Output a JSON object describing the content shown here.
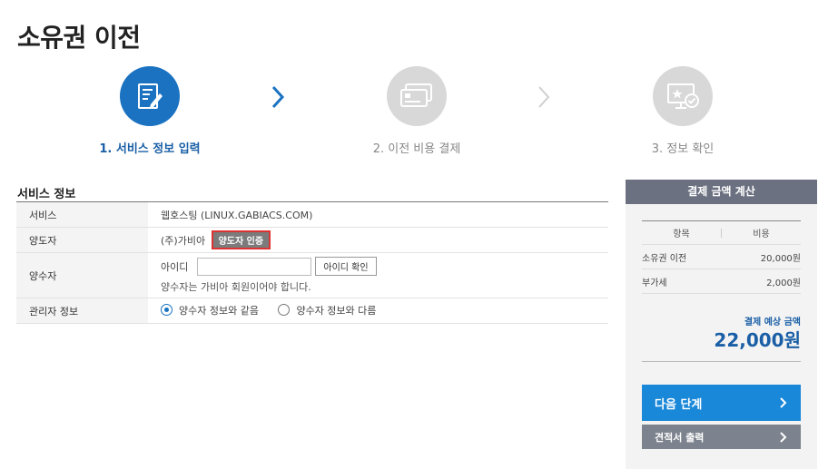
{
  "page": {
    "title": "소유권 이전"
  },
  "steps": [
    {
      "label": "1. 서비스 정보 입력",
      "icon": "form-edit-icon",
      "state": "active"
    },
    {
      "label": "2. 이전 비용 결제",
      "icon": "credit-card-icon",
      "state": "inactive"
    },
    {
      "label": "3. 정보 확인",
      "icon": "monitor-check-icon",
      "state": "inactive"
    }
  ],
  "service_info": {
    "title": "서비스 정보",
    "rows": {
      "service": {
        "label": "서비스",
        "value": "웹호스팅 (LINUX.GABIACS.COM)"
      },
      "transferor": {
        "label": "양도자",
        "value": "(주)가비아",
        "button": "양도자 인증"
      },
      "transferee": {
        "label": "양수자",
        "id_label": "아이디",
        "id_value": "",
        "check_button": "아이디 확인",
        "note": "양수자는 가비아 회원이어야 합니다."
      },
      "admin": {
        "label": "관리자 정보",
        "options": [
          "양수자 정보와 같음",
          "양수자 정보와 다름"
        ],
        "selected": "양수자 정보와 같음"
      }
    }
  },
  "payment": {
    "title": "결제 금액 계산",
    "col_item": "항목",
    "col_cost": "비용",
    "items": [
      {
        "name": "소유권 이전",
        "cost": "20,000원"
      },
      {
        "name": "부가세",
        "cost": "2,000원"
      }
    ],
    "total_label": "결제 예상 금액",
    "total_value": "22,000원",
    "next_button": "다음 단계",
    "quote_button": "견적서 출력"
  },
  "colors": {
    "accent": "#1a72c1",
    "next_button": "#1a88d8",
    "panel_head": "#6b7180",
    "inactive_step": "#d8d8d8"
  }
}
